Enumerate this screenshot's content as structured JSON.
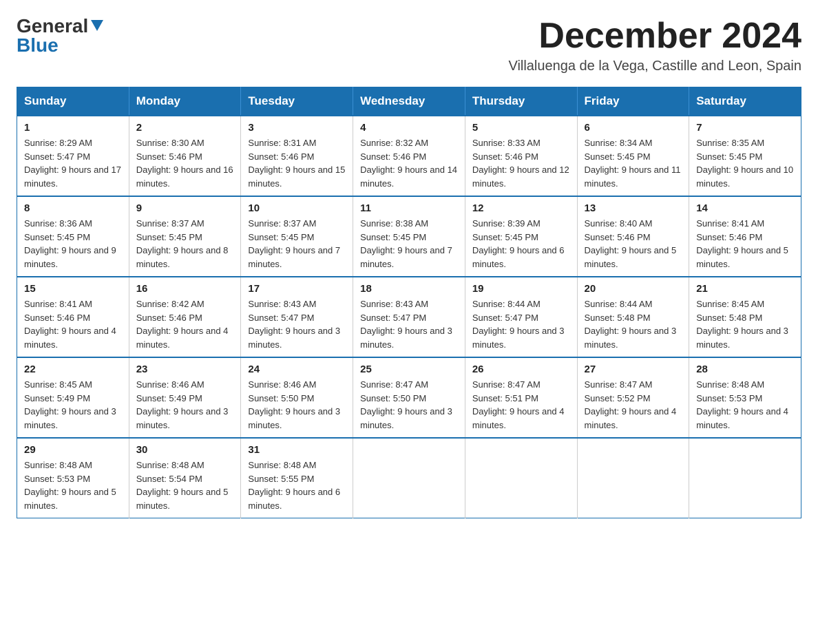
{
  "header": {
    "logo_general": "General",
    "logo_blue": "Blue",
    "month_title": "December 2024",
    "subtitle": "Villaluenga de la Vega, Castille and Leon, Spain"
  },
  "days_of_week": [
    "Sunday",
    "Monday",
    "Tuesday",
    "Wednesday",
    "Thursday",
    "Friday",
    "Saturday"
  ],
  "weeks": [
    [
      {
        "day": "1",
        "sunrise": "Sunrise: 8:29 AM",
        "sunset": "Sunset: 5:47 PM",
        "daylight": "Daylight: 9 hours and 17 minutes."
      },
      {
        "day": "2",
        "sunrise": "Sunrise: 8:30 AM",
        "sunset": "Sunset: 5:46 PM",
        "daylight": "Daylight: 9 hours and 16 minutes."
      },
      {
        "day": "3",
        "sunrise": "Sunrise: 8:31 AM",
        "sunset": "Sunset: 5:46 PM",
        "daylight": "Daylight: 9 hours and 15 minutes."
      },
      {
        "day": "4",
        "sunrise": "Sunrise: 8:32 AM",
        "sunset": "Sunset: 5:46 PM",
        "daylight": "Daylight: 9 hours and 14 minutes."
      },
      {
        "day": "5",
        "sunrise": "Sunrise: 8:33 AM",
        "sunset": "Sunset: 5:46 PM",
        "daylight": "Daylight: 9 hours and 12 minutes."
      },
      {
        "day": "6",
        "sunrise": "Sunrise: 8:34 AM",
        "sunset": "Sunset: 5:45 PM",
        "daylight": "Daylight: 9 hours and 11 minutes."
      },
      {
        "day": "7",
        "sunrise": "Sunrise: 8:35 AM",
        "sunset": "Sunset: 5:45 PM",
        "daylight": "Daylight: 9 hours and 10 minutes."
      }
    ],
    [
      {
        "day": "8",
        "sunrise": "Sunrise: 8:36 AM",
        "sunset": "Sunset: 5:45 PM",
        "daylight": "Daylight: 9 hours and 9 minutes."
      },
      {
        "day": "9",
        "sunrise": "Sunrise: 8:37 AM",
        "sunset": "Sunset: 5:45 PM",
        "daylight": "Daylight: 9 hours and 8 minutes."
      },
      {
        "day": "10",
        "sunrise": "Sunrise: 8:37 AM",
        "sunset": "Sunset: 5:45 PM",
        "daylight": "Daylight: 9 hours and 7 minutes."
      },
      {
        "day": "11",
        "sunrise": "Sunrise: 8:38 AM",
        "sunset": "Sunset: 5:45 PM",
        "daylight": "Daylight: 9 hours and 7 minutes."
      },
      {
        "day": "12",
        "sunrise": "Sunrise: 8:39 AM",
        "sunset": "Sunset: 5:45 PM",
        "daylight": "Daylight: 9 hours and 6 minutes."
      },
      {
        "day": "13",
        "sunrise": "Sunrise: 8:40 AM",
        "sunset": "Sunset: 5:46 PM",
        "daylight": "Daylight: 9 hours and 5 minutes."
      },
      {
        "day": "14",
        "sunrise": "Sunrise: 8:41 AM",
        "sunset": "Sunset: 5:46 PM",
        "daylight": "Daylight: 9 hours and 5 minutes."
      }
    ],
    [
      {
        "day": "15",
        "sunrise": "Sunrise: 8:41 AM",
        "sunset": "Sunset: 5:46 PM",
        "daylight": "Daylight: 9 hours and 4 minutes."
      },
      {
        "day": "16",
        "sunrise": "Sunrise: 8:42 AM",
        "sunset": "Sunset: 5:46 PM",
        "daylight": "Daylight: 9 hours and 4 minutes."
      },
      {
        "day": "17",
        "sunrise": "Sunrise: 8:43 AM",
        "sunset": "Sunset: 5:47 PM",
        "daylight": "Daylight: 9 hours and 3 minutes."
      },
      {
        "day": "18",
        "sunrise": "Sunrise: 8:43 AM",
        "sunset": "Sunset: 5:47 PM",
        "daylight": "Daylight: 9 hours and 3 minutes."
      },
      {
        "day": "19",
        "sunrise": "Sunrise: 8:44 AM",
        "sunset": "Sunset: 5:47 PM",
        "daylight": "Daylight: 9 hours and 3 minutes."
      },
      {
        "day": "20",
        "sunrise": "Sunrise: 8:44 AM",
        "sunset": "Sunset: 5:48 PM",
        "daylight": "Daylight: 9 hours and 3 minutes."
      },
      {
        "day": "21",
        "sunrise": "Sunrise: 8:45 AM",
        "sunset": "Sunset: 5:48 PM",
        "daylight": "Daylight: 9 hours and 3 minutes."
      }
    ],
    [
      {
        "day": "22",
        "sunrise": "Sunrise: 8:45 AM",
        "sunset": "Sunset: 5:49 PM",
        "daylight": "Daylight: 9 hours and 3 minutes."
      },
      {
        "day": "23",
        "sunrise": "Sunrise: 8:46 AM",
        "sunset": "Sunset: 5:49 PM",
        "daylight": "Daylight: 9 hours and 3 minutes."
      },
      {
        "day": "24",
        "sunrise": "Sunrise: 8:46 AM",
        "sunset": "Sunset: 5:50 PM",
        "daylight": "Daylight: 9 hours and 3 minutes."
      },
      {
        "day": "25",
        "sunrise": "Sunrise: 8:47 AM",
        "sunset": "Sunset: 5:50 PM",
        "daylight": "Daylight: 9 hours and 3 minutes."
      },
      {
        "day": "26",
        "sunrise": "Sunrise: 8:47 AM",
        "sunset": "Sunset: 5:51 PM",
        "daylight": "Daylight: 9 hours and 4 minutes."
      },
      {
        "day": "27",
        "sunrise": "Sunrise: 8:47 AM",
        "sunset": "Sunset: 5:52 PM",
        "daylight": "Daylight: 9 hours and 4 minutes."
      },
      {
        "day": "28",
        "sunrise": "Sunrise: 8:48 AM",
        "sunset": "Sunset: 5:53 PM",
        "daylight": "Daylight: 9 hours and 4 minutes."
      }
    ],
    [
      {
        "day": "29",
        "sunrise": "Sunrise: 8:48 AM",
        "sunset": "Sunset: 5:53 PM",
        "daylight": "Daylight: 9 hours and 5 minutes."
      },
      {
        "day": "30",
        "sunrise": "Sunrise: 8:48 AM",
        "sunset": "Sunset: 5:54 PM",
        "daylight": "Daylight: 9 hours and 5 minutes."
      },
      {
        "day": "31",
        "sunrise": "Sunrise: 8:48 AM",
        "sunset": "Sunset: 5:55 PM",
        "daylight": "Daylight: 9 hours and 6 minutes."
      },
      null,
      null,
      null,
      null
    ]
  ]
}
